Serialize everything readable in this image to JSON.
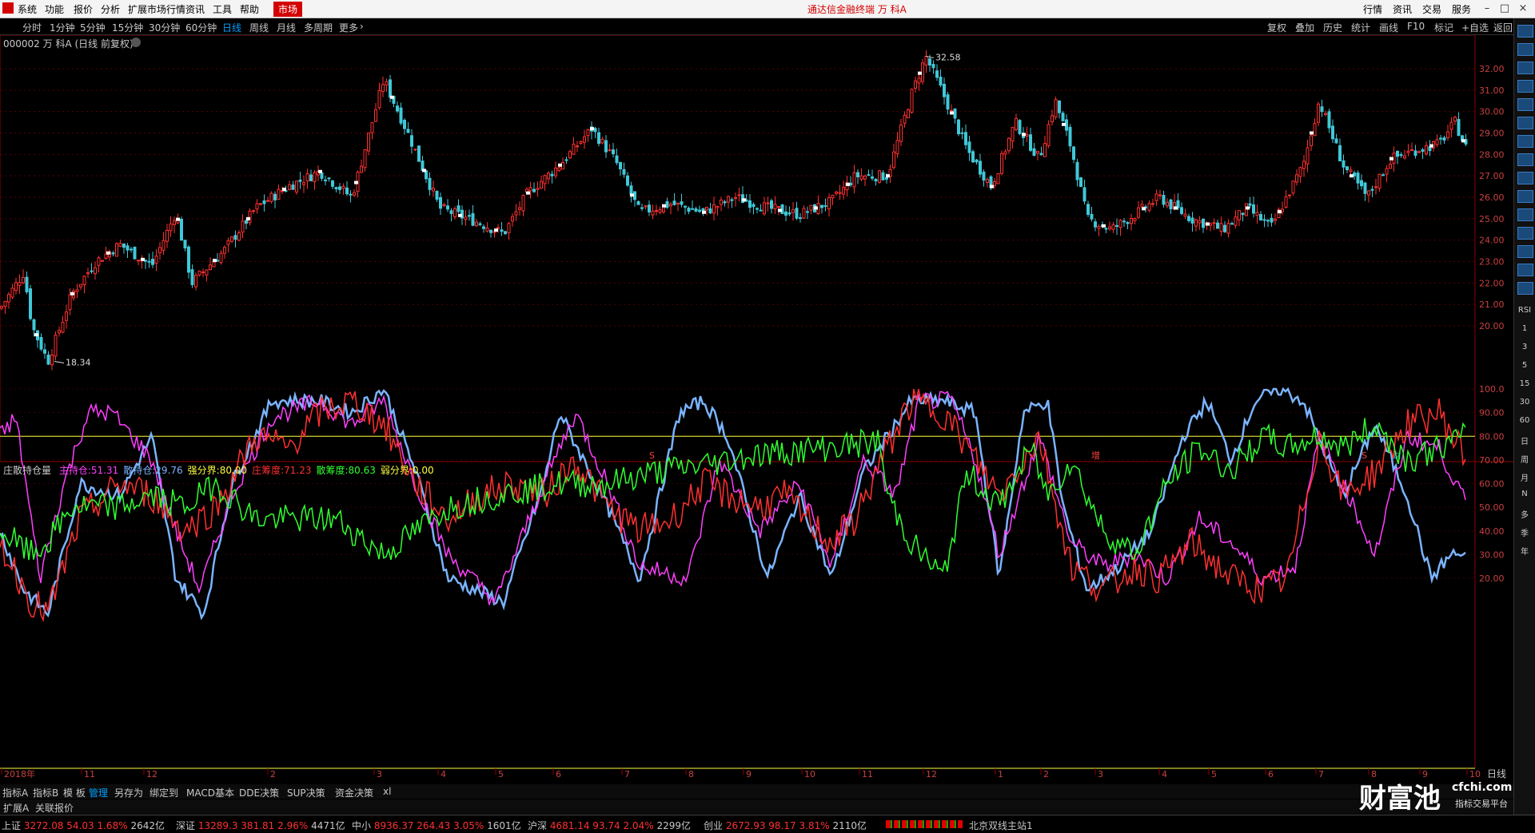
{
  "menu": {
    "items": [
      "系统",
      "功能",
      "报价",
      "分析",
      "扩展市场行情",
      "资讯",
      "工具",
      "帮助"
    ],
    "active": "市场",
    "title": "通达信金融终端  万 科A",
    "right_tabs": [
      "行情",
      "资讯",
      "交易",
      "服务"
    ]
  },
  "periods": {
    "items": [
      "分时",
      "1分钟",
      "5分钟",
      "15分钟",
      "30分钟",
      "60分钟",
      "日线",
      "周线",
      "月线",
      "多周期",
      "更多"
    ],
    "selected": "日线",
    "right_items": [
      "复权",
      "叠加",
      "历史",
      "统计",
      "画线",
      "F10",
      "标记",
      "+自选",
      "返回"
    ]
  },
  "stock": {
    "label": "000002 万 科A (日线 前复权)",
    "high_label": "32.58",
    "low_label": "18.34"
  },
  "price_axis": {
    "ticks": [
      "32.00",
      "31.00",
      "30.00",
      "29.00",
      "28.00",
      "27.00",
      "26.00",
      "25.00",
      "24.00",
      "23.00",
      "22.00",
      "21.00",
      "20.00"
    ]
  },
  "event_markers": [
    "S",
    "增",
    "S",
    "财"
  ],
  "indicator": {
    "name": "庄散持仓量",
    "fields": [
      {
        "label": "主持仓:",
        "value": "51.31",
        "color": "#ff40ff"
      },
      {
        "label": "散持仓:",
        "value": "29.76",
        "color": "#7ab4ff"
      },
      {
        "label": "强分界:",
        "value": "80.00",
        "color": "#ffff40"
      },
      {
        "label": "庄筹度:",
        "value": "71.23",
        "color": "#ff3030"
      },
      {
        "label": "散筹度:",
        "value": "80.63",
        "color": "#30ff30"
      },
      {
        "label": "弱分界:",
        "value": "0.00",
        "color": "#ffff40"
      }
    ],
    "axis_ticks": [
      "100.0",
      "90.00",
      "80.00",
      "70.00",
      "60.00",
      "50.00",
      "40.00",
      "30.00",
      "20.00"
    ]
  },
  "date_axis": {
    "labels": [
      "2018年",
      "11",
      "12",
      "2",
      "3",
      "4",
      "5",
      "6",
      "7",
      "8",
      "9",
      "10",
      "11",
      "12",
      "1",
      "2",
      "3",
      "4",
      "5",
      "6",
      "7",
      "8",
      "9",
      "10"
    ],
    "period_label": "日线"
  },
  "bottom_tabs": {
    "items": [
      "指标A",
      "指标B",
      "模 板",
      "管理",
      "另存为",
      "绑定到",
      "MACD基本",
      "DDE决策",
      "SUP决策",
      "资金决策",
      "xl"
    ],
    "selected": "管理",
    "row2": [
      "扩展A",
      "关联报价"
    ]
  },
  "sidebar": {
    "labels": [
      "RSI",
      "1",
      "3",
      "5",
      "15",
      "30",
      "60",
      "日",
      "周",
      "月",
      "N",
      "多",
      "季",
      "年"
    ]
  },
  "status": {
    "items": [
      {
        "name": "上证",
        "price": "3272.08",
        "chg": "54.03",
        "pct": "1.68%",
        "vol": "2642亿"
      },
      {
        "name": "深证",
        "price": "13289.3",
        "chg": "381.81",
        "pct": "2.96%",
        "vol": "4471亿"
      },
      {
        "name": "中小",
        "price": "8936.37",
        "chg": "264.43",
        "pct": "3.05%",
        "vol": "1601亿"
      },
      {
        "name": "沪深",
        "price": "4681.14",
        "chg": "93.74",
        "pct": "2.04%",
        "vol": "2299亿"
      },
      {
        "name": "创业",
        "price": "2672.93",
        "chg": "98.17",
        "pct": "3.81%",
        "vol": "2110亿"
      }
    ],
    "server": "北京双线主站1"
  },
  "watermark": {
    "text": "财富池",
    "domain": "cfchi.com",
    "tagline": "指标交易平台"
  },
  "colors": {
    "up": "#ff3030",
    "down": "#40c8d8",
    "zhu": "#ff40ff",
    "san": "#7ab4ff",
    "zhuang": "#ff3030",
    "sanchou": "#30ff30",
    "line80": "#ffff40"
  }
}
